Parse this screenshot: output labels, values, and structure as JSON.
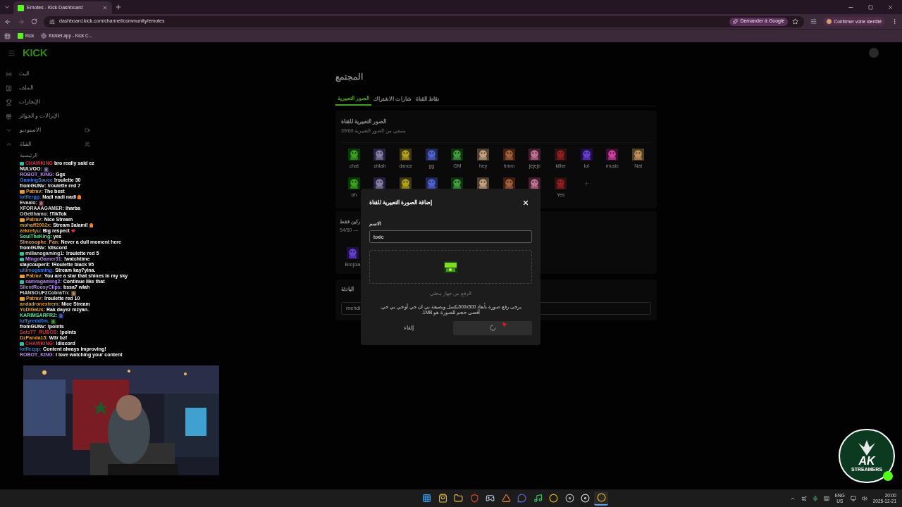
{
  "browser": {
    "tab_title": "Emotes - Kick Dashboard",
    "url": "dashboard.kick.com/channel/community/emotes",
    "ask_google": "Demander à Google",
    "identity": "Confirmer votre identité",
    "bookmarks": [
      {
        "label": "Kick",
        "kind": "kick"
      },
      {
        "label": "Kicklet.app - Kick C...",
        "kind": "globe"
      }
    ]
  },
  "header": {
    "logo": "KICK"
  },
  "sidebar": {
    "items": [
      {
        "kind": "link",
        "label": "البث"
      },
      {
        "kind": "link",
        "label": "الملف"
      },
      {
        "kind": "link",
        "label": "الإنجازات"
      },
      {
        "kind": "link",
        "label": "الإنزالات و الجوائز"
      },
      {
        "kind": "group",
        "label": "الاستوديو",
        "expanded": false
      },
      {
        "kind": "group",
        "label": "القناة",
        "expanded": true,
        "children": [
          {
            "label": "الرئيسية"
          }
        ]
      }
    ]
  },
  "page": {
    "title": "المجتمع",
    "tabs": [
      {
        "label": "نقاط القناة",
        "selected": false
      },
      {
        "label": "شارات الاشتراك",
        "selected": false
      },
      {
        "label": "الصور التعبيرية",
        "selected": true
      }
    ],
    "emote_card": {
      "title": "الصور التعبيرية للقناة",
      "subtitle": "متبقي من الصور التعبيرية 39/60",
      "emotes": [
        {
          "kind": "emote",
          "label": "chat"
        },
        {
          "kind": "emote",
          "label": "chtah"
        },
        {
          "kind": "emote",
          "label": "dance"
        },
        {
          "kind": "emote",
          "label": "gg"
        },
        {
          "kind": "emote",
          "label": "GM"
        },
        {
          "kind": "emote",
          "label": "hey"
        },
        {
          "kind": "emote",
          "label": "hmm"
        },
        {
          "kind": "emote",
          "label": "jejeje"
        },
        {
          "kind": "emote",
          "label": "killer"
        },
        {
          "kind": "emote",
          "label": "lol"
        },
        {
          "kind": "emote",
          "label": "music"
        },
        {
          "kind": "emote",
          "label": "Nat"
        },
        {
          "kind": "emote",
          "label": "oh"
        },
        {
          "kind": "emote"
        },
        {
          "kind": "emote"
        },
        {
          "kind": "emote"
        },
        {
          "kind": "emote"
        },
        {
          "kind": "emote"
        },
        {
          "kind": "emote"
        },
        {
          "kind": "emote"
        },
        {
          "kind": "emote",
          "label": "Yes"
        },
        {
          "kind": "add"
        }
      ]
    },
    "sub_card": {
      "title": "ركين فقط",
      "subtitle": "54/60 —",
      "emotes": [
        {
          "kind": "emote",
          "label": "Brojola"
        }
      ]
    },
    "prefix_card": {
      "title": "البادئة",
      "value": "mehdi"
    }
  },
  "chat": [
    {
      "user": "CHAWKING",
      "color": "#d0304a",
      "badge": {
        "kind": "subscriber"
      },
      "text": "bro really said ez"
    },
    {
      "user": "NULVOO:",
      "trail": {
        "kind": "emote"
      }
    },
    {
      "user": "ROBOT_KING:",
      "color": "#b48ae8",
      "text": "Ggs"
    },
    {
      "user": "GamingSauce",
      "color": "#3a7ad8",
      "text": "!roulette 30"
    },
    {
      "user": "fromGUNv:",
      "text": "!roulette red 7"
    },
    {
      "user": "Patrav:",
      "color": "#e0a030",
      "badge": {
        "kind": "crown"
      },
      "text": "The best"
    },
    {
      "user": "lotfierpp:",
      "color": "#3a7ad8",
      "text": "Nadi nadi nadi",
      "trail": {
        "kind": "fire"
      }
    },
    {
      "user": "Evaalo:",
      "color": "#d8d8d8",
      "trail": {
        "kind": "emote"
      }
    },
    {
      "user": "XFORAAAGAMER:",
      "color": "#d8d8d8",
      "text": "lharba"
    },
    {
      "user": "OGetthamo:",
      "color": "#d8d8d8",
      "text": "!TikTok"
    },
    {
      "user": "Patrav:",
      "color": "#e0a030",
      "badge": {
        "kind": "crown"
      },
      "text": "Nice Stream"
    },
    {
      "user": "mohaff2002x:",
      "color": "#e0a030",
      "text": "Stream 3alami!",
      "trail": {
        "kind": "fire"
      }
    },
    {
      "user": "zekrefyu:",
      "color": "#e0a030",
      "text": "Big respect",
      "trail": {
        "kind": "heart"
      }
    },
    {
      "user": "SoulTheKing:",
      "color": "#60e0a0",
      "text": "yes"
    },
    {
      "user": "Simosophe_Fan:",
      "color": "#d8a070",
      "text": "Never a dull moment here"
    },
    {
      "user": "fromGUNv:",
      "text": "!discord"
    },
    {
      "user": "millanogaming1:",
      "color": "#d8d8d8",
      "badge": {
        "kind": "subscriber"
      },
      "text": "!roulette red 5"
    },
    {
      "user": "MingoGamer31:",
      "color": "#b48ae8",
      "badge": {
        "kind": "subscriber"
      },
      "text": "!watchtime"
    },
    {
      "user": "slaycouper3:",
      "text": "!Roulette black 95"
    },
    {
      "user": "ultimogaming:",
      "color": "#3a7ad8",
      "text": "Stream kay7yina."
    },
    {
      "user": "Patrav:",
      "color": "#e0a030",
      "badge": {
        "kind": "crown"
      },
      "text": "You are a star that shines in my sky"
    },
    {
      "user": "samragaming2:",
      "color": "#b48ae8",
      "badge": {
        "kind": "subscriber"
      },
      "text": "Continue like that"
    },
    {
      "user": "SilentRoosyClips:",
      "color": "#b48ae8",
      "text": "bssa7 wlah"
    },
    {
      "user": "FIANSOUF2CobraTn:",
      "color": "#d8d8d8",
      "trail": {
        "kind": "emote"
      }
    },
    {
      "user": "Patrav:",
      "color": "#e0a030",
      "badge": {
        "kind": "crown"
      },
      "text": "!roulette red 10"
    },
    {
      "user": "andadronextrem:",
      "color": "#e0a030",
      "text": "Nice Stream"
    },
    {
      "user": "YoDIGaUs:",
      "color": "#e0a030",
      "text": "Rak dayez mzyan."
    },
    {
      "user": "KARIMSARFR2:",
      "color": "#60e0a0",
      "trail": {
        "kind": "emote"
      }
    },
    {
      "user": "luffyredd0m:",
      "color": "#3a7ad8",
      "trail": {
        "kind": "emote"
      }
    },
    {
      "user": "fromGUNv:",
      "text": "!points"
    },
    {
      "user": "SatsTT_RUBOS:",
      "color": "#d0304a",
      "text": "!points"
    },
    {
      "user": "DzPanda15:",
      "color": "#e0a030",
      "text": "W3r bzf"
    },
    {
      "user": "CHAWKING:",
      "color": "#d0304a",
      "badge": {
        "kind": "subscriber"
      },
      "text": "!discord"
    },
    {
      "user": "lotfiezpp:",
      "color": "#3a7ad8",
      "text": "Content always improving!"
    },
    {
      "user": "ROBOT_KING:",
      "color": "#b48ae8",
      "text": "I love watching your content"
    }
  ],
  "stream_logo": {
    "line1": "AK",
    "line2": "STREAMERS"
  },
  "modal": {
    "title": "إضافة الصورة التعبيرية للقناة",
    "name_label": "الاسم",
    "name_value": "toxic",
    "upload_hint": "الرفع من جهاز محلي",
    "help": "يرجى رفع صورة بأبعاد 500x500بكسل وبصيغة بي ان جي أو جي بي جي. أقصى حجم للصورة هو 1MB.",
    "cancel": "إلغاء",
    "submitting": true
  },
  "taskbar": {
    "apps": [
      {
        "kind": "windows",
        "selected": false
      },
      {
        "kind": "store",
        "selected": false
      },
      {
        "kind": "folder",
        "selected": false
      },
      {
        "kind": "shield",
        "selected": false
      },
      {
        "kind": "steam",
        "selected": false
      },
      {
        "kind": "triangle",
        "selected": false
      },
      {
        "kind": "discord",
        "selected": false
      },
      {
        "kind": "spotify",
        "selected": false
      },
      {
        "kind": "chrome",
        "selected": false
      },
      {
        "kind": "kick",
        "selected": false
      },
      {
        "kind": "record",
        "selected": false
      },
      {
        "kind": "chrome",
        "selected": true
      }
    ],
    "language": "ENG",
    "region": "US",
    "time": "20:00",
    "date": "2025-12-21"
  }
}
